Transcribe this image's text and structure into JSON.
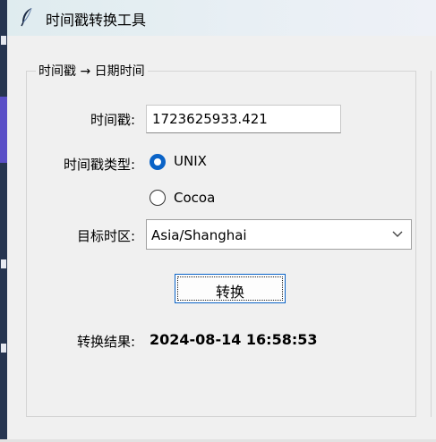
{
  "window": {
    "title": "时间戳转换工具",
    "icon": "feather-icon"
  },
  "group": {
    "title": "时间戳 → 日期时间"
  },
  "form": {
    "timestamp_label": "时间戳:",
    "timestamp_value": "1723625933.421",
    "type_label": "时间戳类型:",
    "type_options": [
      {
        "label": "UNIX",
        "selected": true
      },
      {
        "label": "Cocoa",
        "selected": false
      }
    ],
    "timezone_label": "目标时区:",
    "timezone_value": "Asia/Shanghai",
    "convert_label": "转换",
    "result_label": "转换结果:",
    "result_value": "2024-08-14 16:58:53"
  },
  "colors": {
    "accent": "#0a63c7",
    "background": "#f0f0f0"
  }
}
